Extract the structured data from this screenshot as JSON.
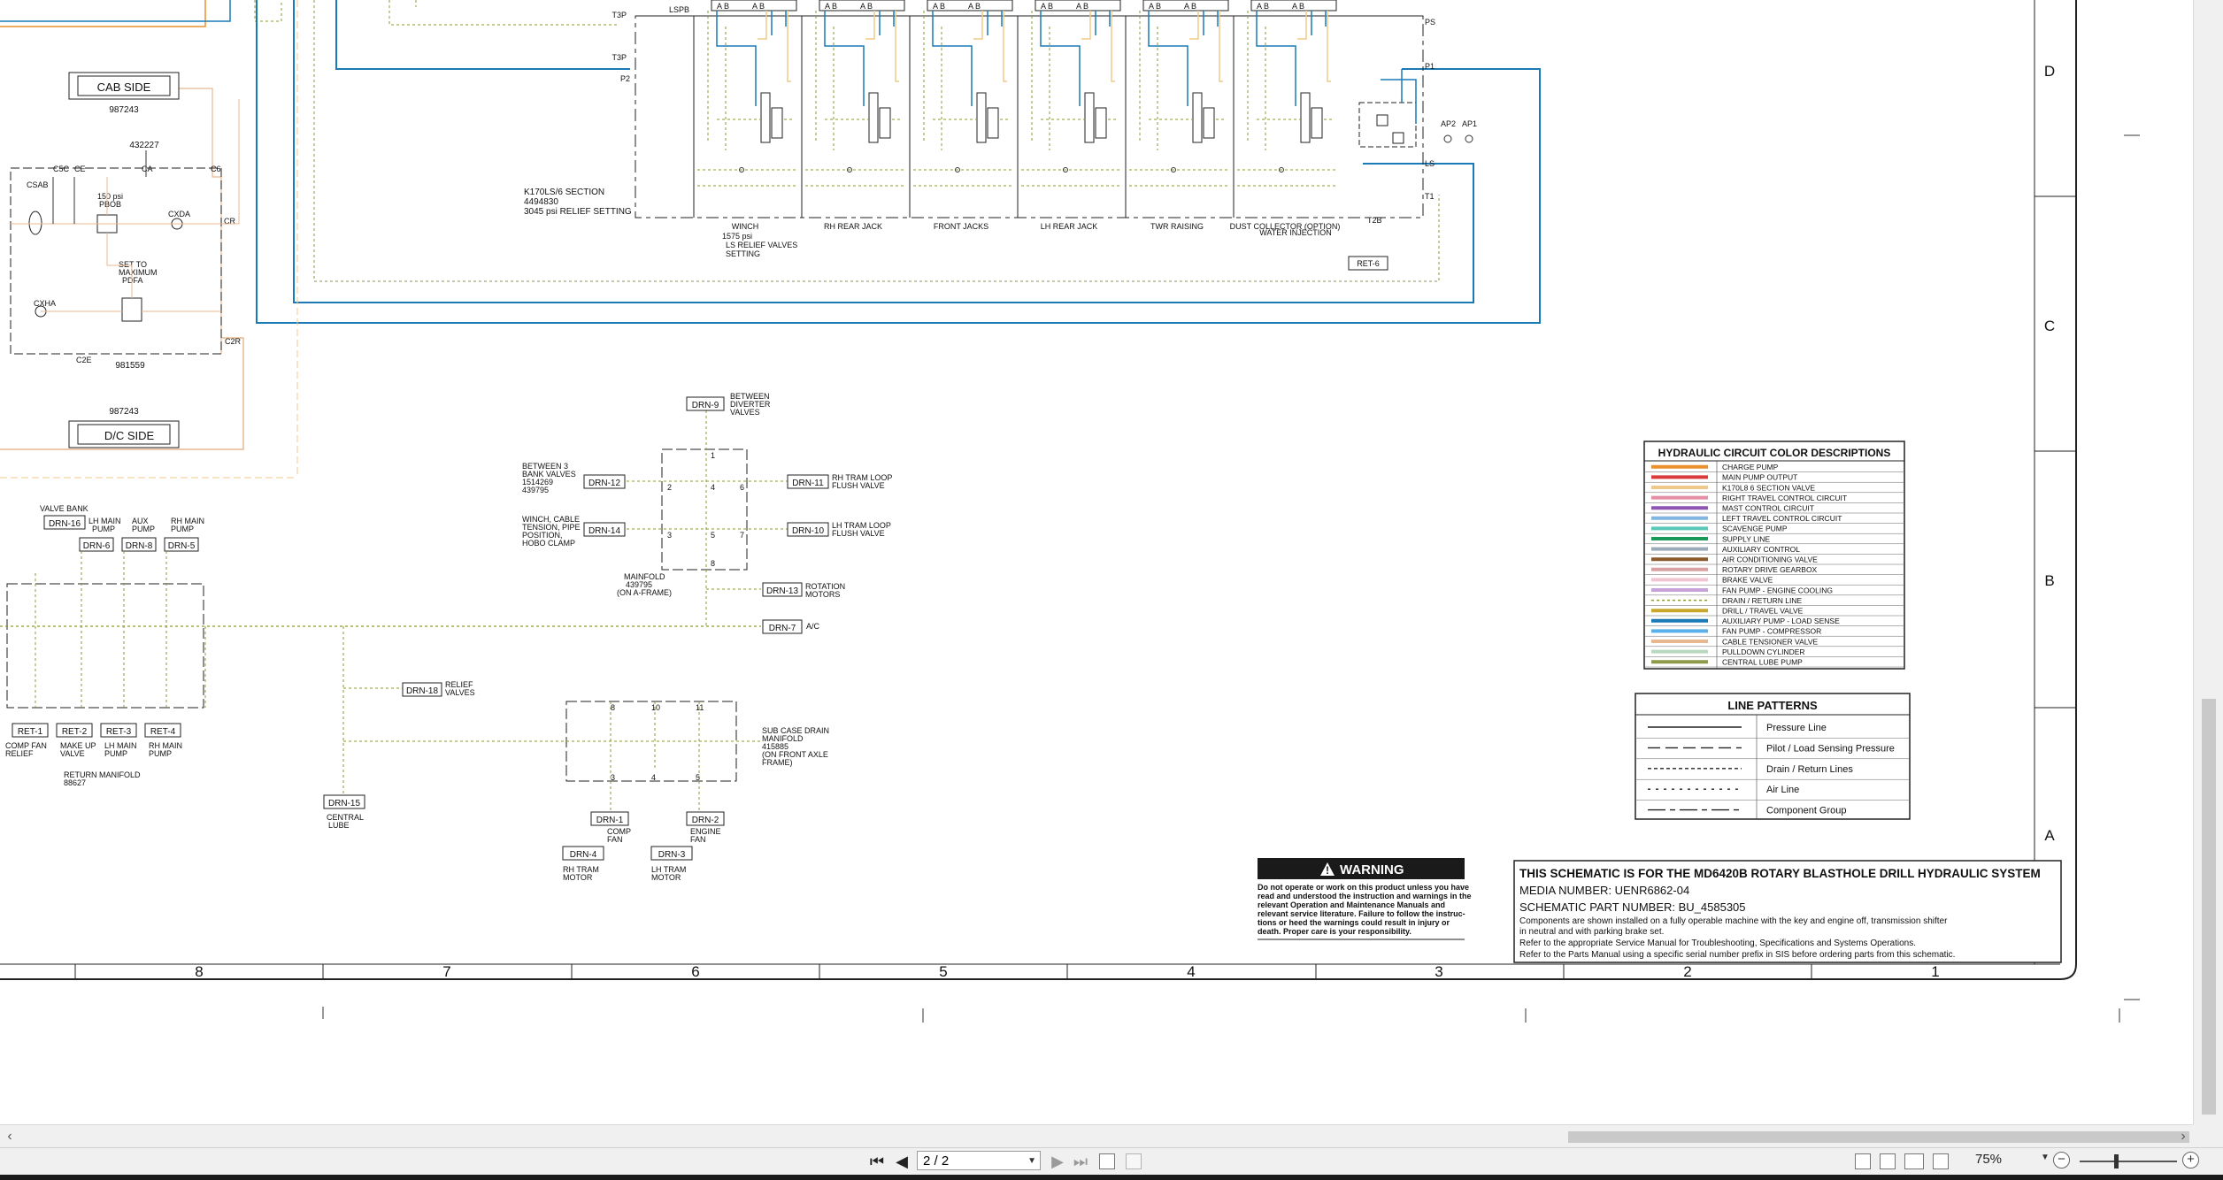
{
  "viewer": {
    "page_nav": {
      "current": "2 / 2"
    },
    "zoom": "75%",
    "zoom_slider_level": 0.35
  },
  "schematic": {
    "zone_rows": [
      "D",
      "C",
      "B",
      "A"
    ],
    "zone_cols": [
      "8",
      "7",
      "6",
      "5",
      "4",
      "3",
      "2",
      "1"
    ],
    "cab_side": {
      "label": "CAB SIDE",
      "part": "987243"
    },
    "dc_side": {
      "label": "D/C SIDE",
      "part": "987243"
    },
    "valve_block": {
      "part_top": "432227",
      "part_bottom": "981559",
      "ports": [
        "C5C",
        "CE",
        "CA",
        "C6",
        "CSAB",
        "CXDA",
        "CXHA",
        "C2E",
        "C2R",
        "CR"
      ],
      "labels": [
        "150 psi",
        "PBOB",
        "SET TO",
        "MAXIMUM",
        "PDFA"
      ]
    },
    "k170": {
      "note1": "K170LS/6 SECTION",
      "note2": "4494830",
      "note3": "3045 psi RELIEF SETTING",
      "port_labels": [
        "LSPB",
        "T3P",
        "P1",
        "P2",
        "PS",
        "T2B",
        "LS",
        "T1",
        "AP2",
        "AP1"
      ],
      "sections": [
        "WINCH",
        "RH REAR JACK",
        "FRONT JACKS",
        "LH REAR JACK",
        "TWR RAISING",
        "DUST COLLECTOR (OPTION)"
      ],
      "sub_labels": [
        "1575 psi",
        "LS RELIEF VALVES",
        "SETTING",
        "WATER INJECTION"
      ],
      "ab_label": "A B",
      "ret": "RET-6"
    },
    "drains": {
      "drn9": "DRN-9",
      "drn9_desc": [
        "BETWEEN",
        "DIVERTER",
        "VALVES"
      ],
      "drn12": "DRN-12",
      "drn12_desc": [
        "BETWEEN 3",
        "BANK VALVES",
        "1514269",
        "439795"
      ],
      "drn14": "DRN-14",
      "drn14_desc": [
        "WINCH, CABLE",
        "TENSION, PIPE",
        "POSITION,",
        "HOBO CLAMP"
      ],
      "drn11": "DRN-11",
      "drn11_desc": [
        "RH TRAM LOOP",
        "FLUSH VALVE"
      ],
      "drn10": "DRN-10",
      "drn10_desc": [
        "LH TRAM LOOP",
        "FLUSH VALVE"
      ],
      "drn13": "DRN-13",
      "drn13_desc": [
        "ROTATION",
        "MOTORS"
      ],
      "drn7": "DRN-7",
      "drn7_desc": "A/C",
      "drn18": "DRN-18",
      "drn18_desc": [
        "RELIEF",
        "VALVES"
      ],
      "drn15": "DRN-15",
      "drn15_desc": [
        "CENTRAL",
        "LUBE"
      ],
      "drn1": "DRN-1",
      "drn1_desc": [
        "COMP",
        "FAN"
      ],
      "drn2": "DRN-2",
      "drn2_desc": [
        "ENGINE",
        "FAN"
      ],
      "drn4": "DRN-4",
      "drn4_desc": [
        "RH TRAM",
        "MOTOR"
      ],
      "drn3": "DRN-3",
      "drn3_desc": [
        "LH TRAM",
        "MOTOR"
      ],
      "drn16": "DRN-16",
      "drn6": "DRN-6",
      "drn8": "DRN-8",
      "drn5": "DRN-5",
      "mainfold_desc": [
        "MAINFOLD",
        "439795",
        "(ON A-FRAME)"
      ],
      "subcase_desc": [
        "SUB CASE DRAIN",
        "MANIFOLD",
        "415885",
        "(ON FRONT AXLE",
        "FRAME)"
      ]
    },
    "valve_bank": {
      "title": "VALVE BANK",
      "labels": [
        "LH MAIN",
        "PUMP",
        "AUX",
        "PUMP",
        "RH MAIN",
        "PUMP"
      ]
    },
    "return_manifold": {
      "rets": [
        "RET-1",
        "RET-2",
        "RET-3",
        "RET-4"
      ],
      "ret_desc": [
        [
          "COMP FAN",
          "RELIEF"
        ],
        [
          "MAKE UP",
          "VALVE"
        ],
        [
          "LH MAIN",
          "PUMP"
        ],
        [
          "RH MAIN",
          "PUMP"
        ]
      ],
      "title": "RETURN MANIFOLD",
      "part": "88627"
    },
    "color_legend": {
      "title": "HYDRAULIC CIRCUIT COLOR DESCRIPTIONS",
      "items": [
        {
          "label": "CHARGE PUMP",
          "color": "#e8912e",
          "style": "solid"
        },
        {
          "label": "MAIN PUMP OUTPUT",
          "color": "#d93b3b",
          "style": "solid"
        },
        {
          "label": "K170L8 6 SECTION VALVE",
          "color": "#f0c88a",
          "style": "solid"
        },
        {
          "label": "RIGHT TRAVEL CONTROL CIRCUIT",
          "color": "#e58fa5",
          "style": "solid"
        },
        {
          "label": "MAST CONTROL CIRCUIT",
          "color": "#8e55b5",
          "style": "solid"
        },
        {
          "label": "LEFT TRAVEL CONTROL CIRCUIT",
          "color": "#7fb5e0",
          "style": "solid"
        },
        {
          "label": "SCAVENGE PUMP",
          "color": "#5ac8b8",
          "style": "solid"
        },
        {
          "label": "SUPPLY LINE",
          "color": "#1a9a5a",
          "style": "solid"
        },
        {
          "label": "AUXILIARY CONTROL",
          "color": "#9aaab8",
          "style": "solid"
        },
        {
          "label": "AIR CONDITIONING VALVE",
          "color": "#8a5a2a",
          "style": "solid"
        },
        {
          "label": "ROTARY DRIVE GEARBOX",
          "color": "#d9a2a2",
          "style": "solid"
        },
        {
          "label": "BRAKE VALVE",
          "color": "#f2c4d0",
          "style": "solid"
        },
        {
          "label": "FAN PUMP - ENGINE COOLING",
          "color": "#c8a2d8",
          "style": "solid"
        },
        {
          "label": "DRAIN / RETURN LINE",
          "color": "#8a9a3a",
          "style": "dotted"
        },
        {
          "label": "DRILL / TRAVEL VALVE",
          "color": "#c8a82a",
          "style": "solid"
        },
        {
          "label": "AUXILIARY PUMP - LOAD SENSE",
          "color": "#1a7ab5",
          "style": "solid"
        },
        {
          "label": "FAN PUMP - COMPRESSOR",
          "color": "#5ab0e8",
          "style": "solid"
        },
        {
          "label": "CABLE TENSIONER VALVE",
          "color": "#e8b890",
          "style": "solid"
        },
        {
          "label": "PULLDOWN CYLINDER",
          "color": "#b8d8c0",
          "style": "solid"
        },
        {
          "label": "CENTRAL LUBE PUMP",
          "color": "#8f9a48",
          "style": "solid"
        }
      ]
    },
    "line_patterns": {
      "title": "LINE PATTERNS",
      "items": [
        {
          "label": "Pressure Line",
          "dash": "none"
        },
        {
          "label": "Pilot / Load Sensing Pressure",
          "dash": "14 6"
        },
        {
          "label": "Drain / Return Lines",
          "dash": "4 3"
        },
        {
          "label": "Air Line",
          "dash": "3 6"
        },
        {
          "label": "Component Group",
          "dash": "20 5 6 5"
        }
      ]
    },
    "warning": {
      "title": "WARNING",
      "lines": [
        "Do not operate or work on this product unless you have",
        "read and understood the instruction and warnings in the",
        "relevant Operation and Maintenance Manuals and",
        "relevant service literature. Failure to follow the instruc-",
        "tions or heed the warnings could result in injury or",
        "death. Proper care is your responsibility."
      ]
    },
    "title_block": {
      "title": "THIS SCHEMATIC IS FOR THE MD6420B ROTARY BLASTHOLE DRILL HYDRAULIC SYSTEM",
      "media": "MEDIA NUMBER: UENR6862-04",
      "part": "SCHEMATIC PART NUMBER: BU_4585305",
      "notes": [
        "Components are shown installed on a fully operable machine with the key and engine off, transmission shifter",
        "in neutral and with parking brake set.",
        "Refer to the appropriate Service Manual for Troubleshooting, Specifications and Systems Operations.",
        "Refer to the Parts Manual using a specific serial number prefix in SIS before ordering parts from this schematic."
      ]
    }
  }
}
